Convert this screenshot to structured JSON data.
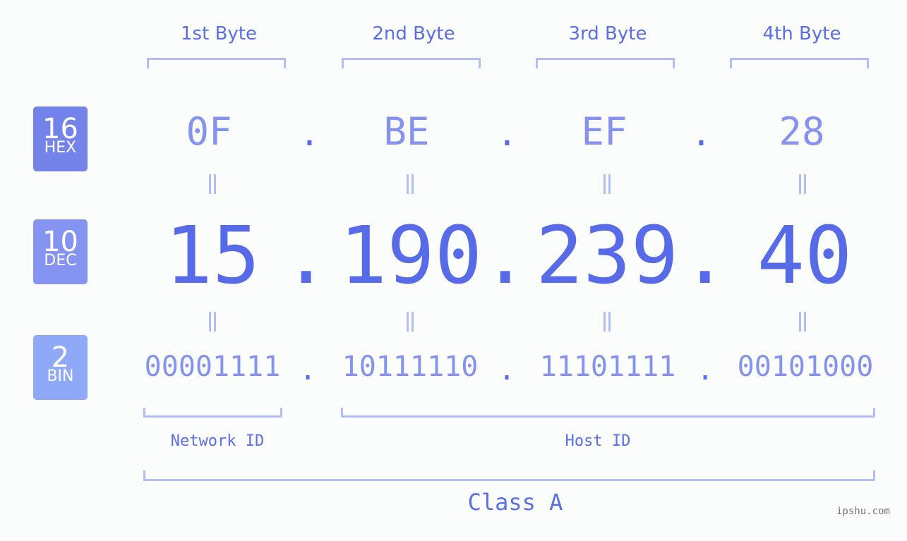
{
  "bytes": [
    {
      "header": "1st Byte",
      "hex": "0F",
      "dec": "15",
      "bin": "00001111"
    },
    {
      "header": "2nd Byte",
      "hex": "BE",
      "dec": "190",
      "bin": "10111110"
    },
    {
      "header": "3rd Byte",
      "hex": "EF",
      "dec": "239",
      "bin": "11101111"
    },
    {
      "header": "4th Byte",
      "hex": "28",
      "dec": "40",
      "bin": "00101000"
    }
  ],
  "separator": ".",
  "badges": {
    "hex": {
      "base": "16",
      "label": "HEX",
      "color": "#7383ea"
    },
    "dec": {
      "base": "10",
      "label": "DEC",
      "color": "#8594f0"
    },
    "bin": {
      "base": "2",
      "label": "BIN",
      "color": "#8fa8f8"
    }
  },
  "labels": {
    "network_id": "Network ID",
    "host_id": "Host ID",
    "ip_class": "Class A"
  },
  "watermark": "ipshu.com",
  "colors": {
    "accent": "#576be9",
    "light": "#8592ee",
    "bracket": "#b3bdf7"
  }
}
